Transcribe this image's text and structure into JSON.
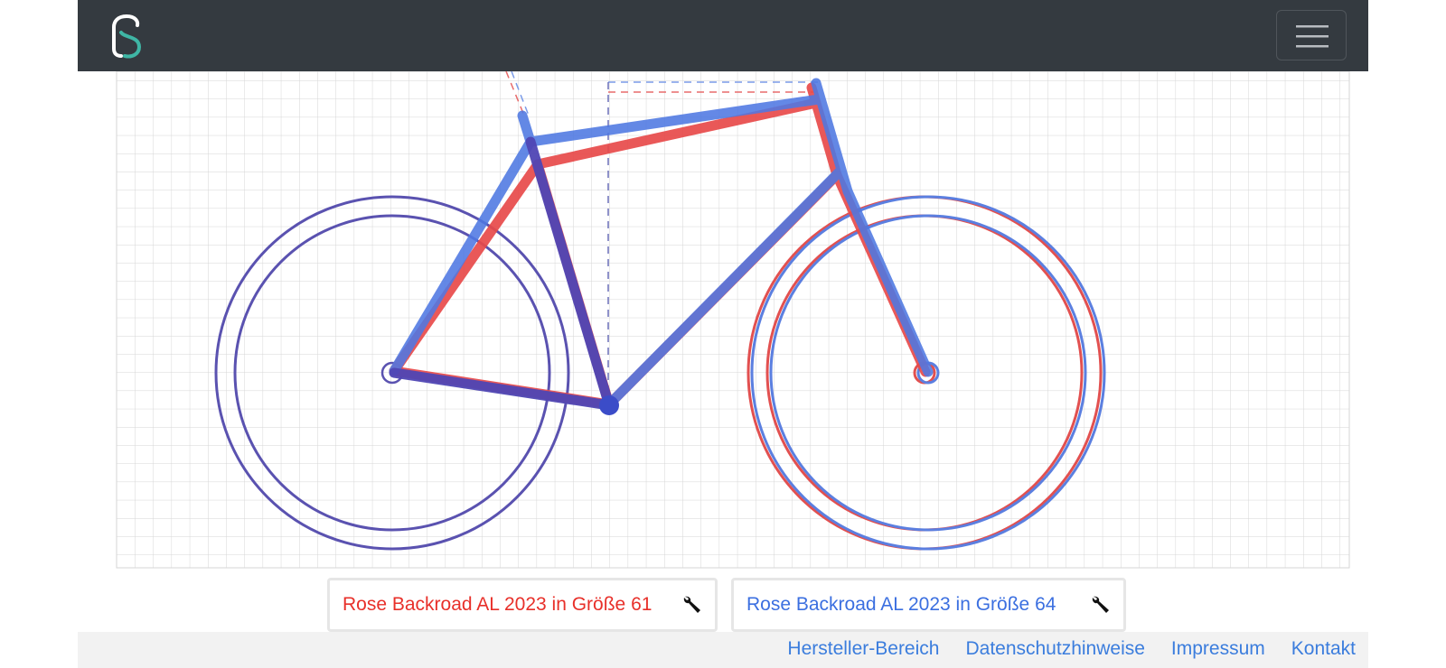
{
  "navbar": {
    "logo": "S-logo-icon",
    "menu_icon": "hamburger-icon",
    "background": "#343a40"
  },
  "bikes": [
    {
      "label": "Rose Backroad AL 2023 in Größe 61",
      "color": "#e8302a",
      "tool_icon": "wrench-icon"
    },
    {
      "label": "Rose Backroad AL 2023 in Größe 64",
      "color": "#3b6fe0",
      "tool_icon": "wrench-icon"
    }
  ],
  "footer": {
    "links": [
      "Hersteller-Bereich",
      "Datenschutzhinweise",
      "Impressum",
      "Kontakt"
    ],
    "link_color": "#3b7ddd"
  }
}
